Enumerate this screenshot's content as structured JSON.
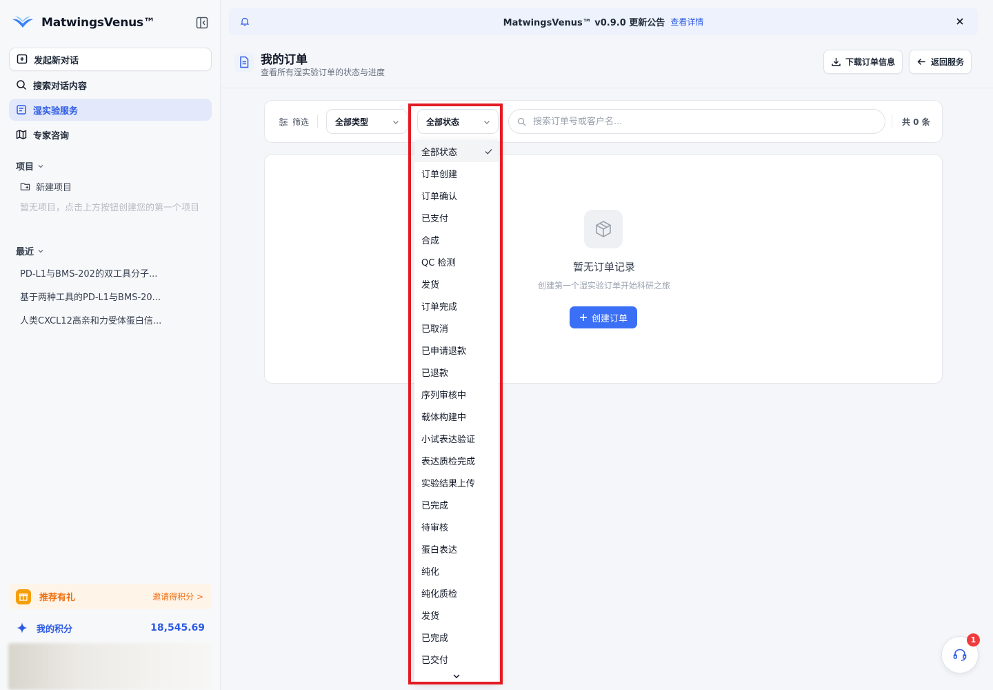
{
  "sidebar": {
    "brand": "MatwingsVenus™",
    "nav": {
      "new_chat": "发起新对话",
      "search": "搜索对话内容",
      "wet_lab": "湿实验服务",
      "expert": "专家咨询"
    },
    "projects": {
      "title": "项目",
      "new_project": "新建项目",
      "empty": "暂无项目，点击上方按钮创建您的第一个项目"
    },
    "recent": {
      "title": "最近",
      "items": [
        "PD-L1与BMS-202的双工具分子...",
        "基于两种工具的PD-L1与BMS-20...",
        "人类CXCL12高亲和力受体蛋白信..."
      ]
    },
    "referral": {
      "label": "推荐有礼",
      "link": "邀请得积分 >"
    },
    "points": {
      "label": "我的积分",
      "value": "18,545.69"
    }
  },
  "announcement": {
    "text": "MatwingsVenus™ v0.9.0 更新公告",
    "link": "查看详情"
  },
  "header": {
    "title": "我的订单",
    "subtitle": "查看所有湿实验订单的状态与进度",
    "download_label": "下载订单信息",
    "back_label": "返回服务"
  },
  "filters": {
    "label": "筛选",
    "type_select": "全部类型",
    "status_select": "全部状态",
    "search_placeholder": "搜索订单号或客户名...",
    "total": "共 0 条"
  },
  "empty_state": {
    "title": "暂无订单记录",
    "subtitle": "创建第一个湿实验订单开始科研之旅",
    "create_label": "创建订单"
  },
  "status_dropdown": {
    "selected": "全部状态",
    "options": [
      "全部状态",
      "订单创建",
      "订单确认",
      "已支付",
      "合成",
      "QC 检测",
      "发货",
      "订单完成",
      "已取消",
      "已申请退款",
      "已退款",
      "序列审核中",
      "载体构建中",
      "小试表达验证",
      "表达质检完成",
      "实验结果上传",
      "已完成",
      "待审核",
      "蛋白表达",
      "纯化",
      "纯化质检",
      "发货",
      "已完成",
      "已交付"
    ]
  },
  "support": {
    "badge": "1"
  },
  "colors": {
    "accent": "#2d5be3",
    "primary_button": "#3b6ff5",
    "referral": "#f07010",
    "highlight_border": "#e31b23"
  }
}
